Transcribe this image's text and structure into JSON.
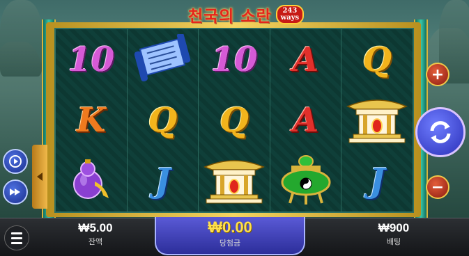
{
  "title": {
    "name": "천국의 소란",
    "ways_number": "243",
    "ways_label": "ways"
  },
  "reels": [
    [
      "10",
      "K",
      "purple-gourd"
    ],
    [
      "blue-scroll",
      "Q",
      "J"
    ],
    [
      "10",
      "Q",
      "golden-temple"
    ],
    [
      "A",
      "A",
      "green-urn"
    ],
    [
      "Q",
      "golden-temple",
      "J"
    ]
  ],
  "symbol_styles": {
    "10": "pink",
    "K": "orange",
    "Q": "gold",
    "A": "red",
    "J": "blue"
  },
  "balance": {
    "value": "₩5.00",
    "label": "잔액"
  },
  "win": {
    "value": "₩0.00",
    "label": "당첨금"
  },
  "bet": {
    "value": "₩900",
    "label": "배팅"
  },
  "controls": {
    "plus": "+",
    "minus": "−"
  },
  "icons": {
    "menu": "hamburger-icon",
    "spin": "refresh-arrows-icon",
    "autoplay": "play-circle-icon",
    "turbo": "fast-forward-icon",
    "panel_toggle": "triangle-left-icon"
  }
}
